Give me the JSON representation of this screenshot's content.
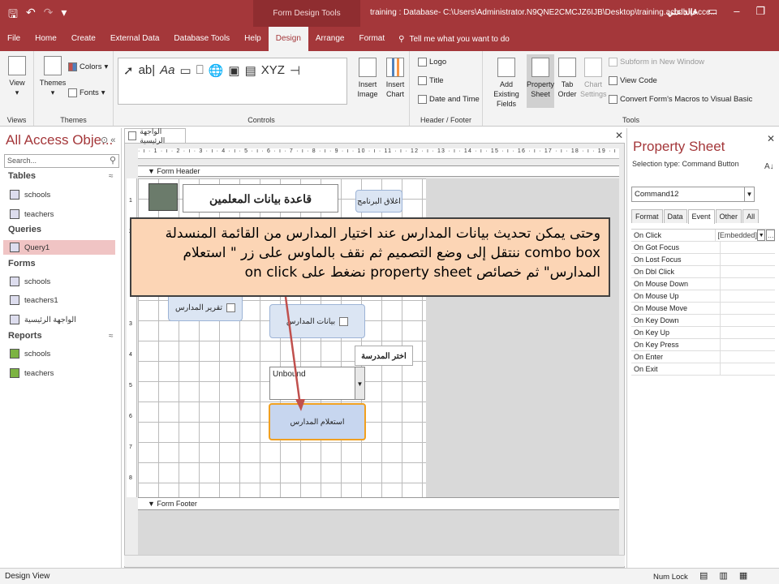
{
  "titlebar": {
    "context_tools": "Form Design Tools",
    "window_title": "training : Database- C:\\Users\\Administrator.N9QNE2CMCJZ6IJB\\Desktop\\training.accdb (Acce...",
    "user": "خالد علي",
    "qat_icons": [
      "save-icon",
      "undo-icon",
      "redo-icon",
      "customize-icon"
    ],
    "window_controls": [
      "restore-ribbon-icon",
      "minimize-icon",
      "maximize-icon",
      "close-icon"
    ]
  },
  "menu": {
    "tabs": [
      "File",
      "Home",
      "Create",
      "External Data",
      "Database Tools",
      "Help",
      "Design",
      "Arrange",
      "Format"
    ],
    "active": "Design",
    "tell_me": "Tell me what you want to do"
  },
  "ribbon": {
    "views": {
      "label": "Views",
      "view": "View"
    },
    "themes": {
      "label": "Themes",
      "themes": "Themes",
      "colors": "Colors",
      "fonts": "Fonts"
    },
    "controls": {
      "label": "Controls",
      "insert_image": "Insert Image",
      "insert_chart": "Insert Chart"
    },
    "header_footer": {
      "label": "Header / Footer",
      "logo": "Logo",
      "title": "Title",
      "date_time": "Date and Time"
    },
    "tools": {
      "label": "Tools",
      "add_fields": "Add Existing Fields",
      "property_sheet": "Property Sheet",
      "tab_order": "Tab Order",
      "chart_settings": "Chart Settings",
      "subform": "Subform in New Window",
      "view_code": "View Code",
      "convert": "Convert Form's Macros to Visual Basic"
    }
  },
  "nav": {
    "title": "All Access Obje...",
    "search_placeholder": "Search...",
    "sections": [
      {
        "name": "Tables",
        "items": [
          "schools",
          "teachers"
        ]
      },
      {
        "name": "Queries",
        "items": [
          "Query1"
        ]
      },
      {
        "name": "Forms",
        "items": [
          "schools",
          "teachers1",
          "الواجهة الرئيسية"
        ]
      },
      {
        "name": "Reports",
        "items": [
          "schools",
          "teachers"
        ]
      }
    ],
    "selected": "Query1"
  },
  "document": {
    "tab_label": "الواجهة الرئيسية",
    "ruler_h": "· ı · 1 · ı · 2 · ı · 3 · ı · 4 · ı · 5 · ı · 6 · ı · 7 · ı · 8 · ı · 9 · ı · 10 · ı · 11 · ı · 12 · ı · 13 · ı · 14 · ı · 15 · ı · 16 · ı · 17 · ı · 18 · ı · 19 · ı · 20 · ı · 21 · ı · 22",
    "ruler_v": [
      "1",
      "2",
      "3",
      "4",
      "5",
      "6",
      "7",
      "8"
    ],
    "form_header": "Form Header",
    "form_footer": "Form Footer",
    "header_title": "قاعدة بيانات المعلمين",
    "close_app_button": "اغلاق البرنامج",
    "report_button": "تقرير المدارس",
    "school_data_button": "بيانات المدارس",
    "choose_school_label": "اختر المدرسة",
    "combo_value": "Unbound",
    "query_button": "استعلام المدارس"
  },
  "callout": {
    "text": "وحتى يمكن تحديث بيانات المدارس عند اختيار المدارس من القائمة المنسدلة combo box ننتقل إلى وضع التصميم ثم نقف بالماوس على زر \" استعلام المدارس\" ثم خصائص property sheet نضغط على on click"
  },
  "property_sheet": {
    "title": "Property Sheet",
    "selection_type": "Selection type:  Command Button",
    "object": "Command12",
    "tabs": [
      "Format",
      "Data",
      "Event",
      "Other",
      "All"
    ],
    "active_tab": "Event",
    "events": [
      {
        "name": "On Click",
        "value": "[Embedded]"
      },
      {
        "name": "On Got Focus",
        "value": ""
      },
      {
        "name": "On Lost Focus",
        "value": ""
      },
      {
        "name": "On Dbl Click",
        "value": ""
      },
      {
        "name": "On Mouse Down",
        "value": ""
      },
      {
        "name": "On Mouse Up",
        "value": ""
      },
      {
        "name": "On Mouse Move",
        "value": ""
      },
      {
        "name": "On Key Down",
        "value": ""
      },
      {
        "name": "On Key Up",
        "value": ""
      },
      {
        "name": "On Key Press",
        "value": ""
      },
      {
        "name": "On Enter",
        "value": ""
      },
      {
        "name": "On Exit",
        "value": ""
      }
    ]
  },
  "status": {
    "mode": "Design View",
    "numlock": "Num Lock"
  },
  "colors": {
    "accent": "#a4373a",
    "callout": "#fcd5b5",
    "arrow": "#c0504d"
  }
}
